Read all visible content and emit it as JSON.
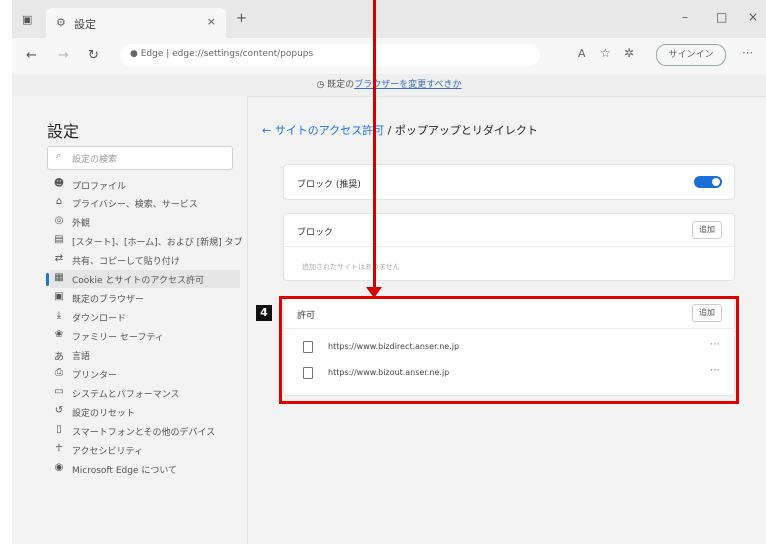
{
  "browser": {
    "tab_icon": "settings-gear",
    "tab_title": "設定",
    "tab_close": "×",
    "new_tab": "+",
    "minimize": "–",
    "maximize": "□",
    "close": "×",
    "address_prefix": "Edge",
    "address_url": "edge://settings/content/popups",
    "signin_label": "サインイン",
    "info_bar_prefix": "既定の",
    "info_bar_link": "ブラウザーを変更すべきか"
  },
  "sidebar": {
    "title": "設定",
    "search_placeholder": "設定の検索",
    "items": [
      {
        "icon": "profile-icon",
        "label": "プロファイル"
      },
      {
        "icon": "lock-icon",
        "label": "プライバシー、検索、サービス"
      },
      {
        "icon": "appearance-icon",
        "label": "外観"
      },
      {
        "icon": "start-icon",
        "label": "[スタート]、[ホーム]、および [新規] タブ"
      },
      {
        "icon": "share-icon",
        "label": "共有、コピーして貼り付け"
      },
      {
        "icon": "cookie-icon",
        "label": "Cookie とサイトのアクセス許可"
      },
      {
        "icon": "browser-icon",
        "label": "既定のブラウザー"
      },
      {
        "icon": "download-icon",
        "label": "ダウンロード"
      },
      {
        "icon": "family-icon",
        "label": "ファミリー セーフティ"
      },
      {
        "icon": "language-icon",
        "label": "言語"
      },
      {
        "icon": "printer-icon",
        "label": "プリンター"
      },
      {
        "icon": "system-icon",
        "label": "システムとパフォーマンス"
      },
      {
        "icon": "reset-icon",
        "label": "設定のリセット"
      },
      {
        "icon": "phone-icon",
        "label": "スマートフォンとその他のデバイス"
      },
      {
        "icon": "accessibility-icon",
        "label": "アクセシビリティ"
      },
      {
        "icon": "edge-icon",
        "label": "Microsoft Edge について"
      }
    ]
  },
  "main": {
    "breadcrumb_back": "←",
    "breadcrumb_parent": "サイトのアクセス許可",
    "breadcrumb_sep": " / ",
    "breadcrumb_current": "ポップアップとリダイレクト",
    "block_toggle_label": "ブロック (推奨)",
    "block_toggle_on": true,
    "block_section_label": "ブロック",
    "block_add": "追加",
    "block_empty": "追加されたサイトはありません",
    "allow_section_label": "許可",
    "allow_add": "追加",
    "allow_sites": [
      "https://www.bizdirect.anser.ne.jp",
      "https://www.bizout.anser.ne.jp"
    ],
    "row_more": "⋯"
  },
  "annotation": {
    "step_number": "4",
    "highlight_color": "#e00000"
  }
}
